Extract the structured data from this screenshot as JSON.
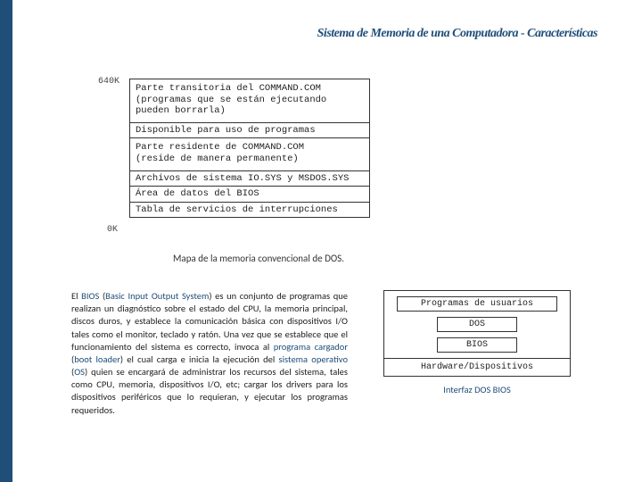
{
  "title": "Sistema de Memoria de una Computadora - Características",
  "memmap": {
    "topLabel": "640K",
    "botLabel": "0K",
    "rows": {
      "r1a": "Parte transitoria del COMMAND.COM",
      "r1b": "(programas que se están ejecutando",
      "r1c": "pueden borrarla)",
      "r2": "Disponible para uso de programas",
      "r3a": "Parte residente de COMMAND.COM",
      "r3b": "(reside de manera permanente)",
      "r4": "Archivos de sistema IO.SYS y MSDOS.SYS",
      "r5": "Área de datos del BIOS",
      "r6": "Tabla de servicios de interrupciones"
    },
    "caption": "Mapa de la memoria convencional de DOS."
  },
  "para": {
    "t1": "El ",
    "bios": "BIOS",
    "t2": " (",
    "biosLong": "Basic Input Output System",
    "t3": ") es un conjunto de programas que realizan un diagnóstico sobre el estado del CPU, la memoria principal, discos duros, y establece la comunicación básica con dispositivos I/O tales como el monitor, teclado y ratón. Una vez que se establece que el funcionamiento del sistema es correcto, invoca al ",
    "loaderEs": "programa cargador",
    "t4": " (",
    "loaderEn": "boot loader",
    "t5": ") el cual carga e inicia la ejecución del ",
    "osEs": "sistema operativo",
    "t6": " (",
    "osEn": "OS",
    "t7": ") quien se encargará de administrar los recursos del sistema, tales como CPU, memoria, dispositivos I/O, etc; cargar los drivers para los dispositivos periféricos que lo requieran,  y ejecutar los programas requeridos."
  },
  "layers": {
    "user": "Programas de usuarios",
    "dos": "DOS",
    "bios": "BIOS",
    "hw": "Hardware/Dispositivos",
    "caption": "Interfaz DOS BIOS"
  }
}
